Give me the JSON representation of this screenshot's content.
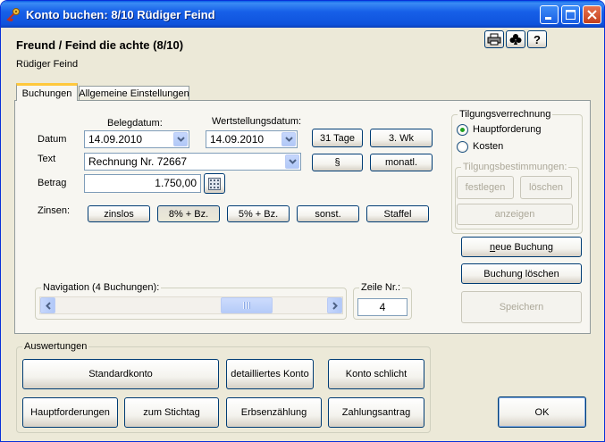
{
  "window": {
    "title": "Konto buchen: 8/10 Rüdiger Feind",
    "icon": "key-icon"
  },
  "header": {
    "title": "Freund / Feind die achte (8/10)",
    "subtitle": "Rüdiger Feind",
    "tool_icons": [
      "printer-icon",
      "club-icon",
      "help-icon"
    ],
    "help_label": "?"
  },
  "tabs": [
    {
      "label": "Buchungen",
      "active": true
    },
    {
      "label": "Allgemeine Einstellungen",
      "active": false
    }
  ],
  "form": {
    "belegdatum_label": "Belegdatum:",
    "wertstellung_label": "Wertstellungsdatum:",
    "datum_label": "Datum",
    "belegdatum_value": "14.09.2010",
    "wertstellung_value": "14.09.2010",
    "text_label": "Text",
    "text_value": "Rechnung Nr. 72667",
    "betrag_label": "Betrag",
    "betrag_value": "1.750,00",
    "zinsen_label": "Zinsen:",
    "date_buttons": {
      "tage": "31 Tage",
      "wk": "3. Wk",
      "paragraph": "§",
      "monatl": "monatl."
    },
    "zinsen_buttons": [
      "zinslos",
      "8% + Bz.",
      "5% + Bz.",
      "sonst.",
      "Staffel"
    ]
  },
  "tilgung": {
    "title": "Tilgungsverrechnung",
    "options": [
      "Hauptforderung",
      "Kosten"
    ],
    "selected": "Hauptforderung",
    "bestimmungen_title": "Tilgungsbestimmungen:",
    "bestimmungen_buttons": {
      "festlegen": "festlegen",
      "loeschen": "löschen",
      "anzeigen": "anzeigen"
    }
  },
  "actions": {
    "neue_buchung_hotkey": "n",
    "neue_buchung_rest": "eue Buchung",
    "buchung_loeschen": "Buchung löschen",
    "speichern": "Speichern"
  },
  "navigation": {
    "title": "Navigation (4 Buchungen):",
    "zeile_label": "Zeile Nr.:",
    "zeile_value": "4",
    "scroll_position": 0.75
  },
  "auswertungen": {
    "title": "Auswertungen",
    "row1": [
      "Standardkonto",
      "detailliertes Konto",
      "Konto schlicht"
    ],
    "row2": [
      "Hauptforderungen",
      "zum Stichtag",
      "Erbsenzählung",
      "Zahlungsantrag"
    ]
  },
  "ok_label": "OK"
}
